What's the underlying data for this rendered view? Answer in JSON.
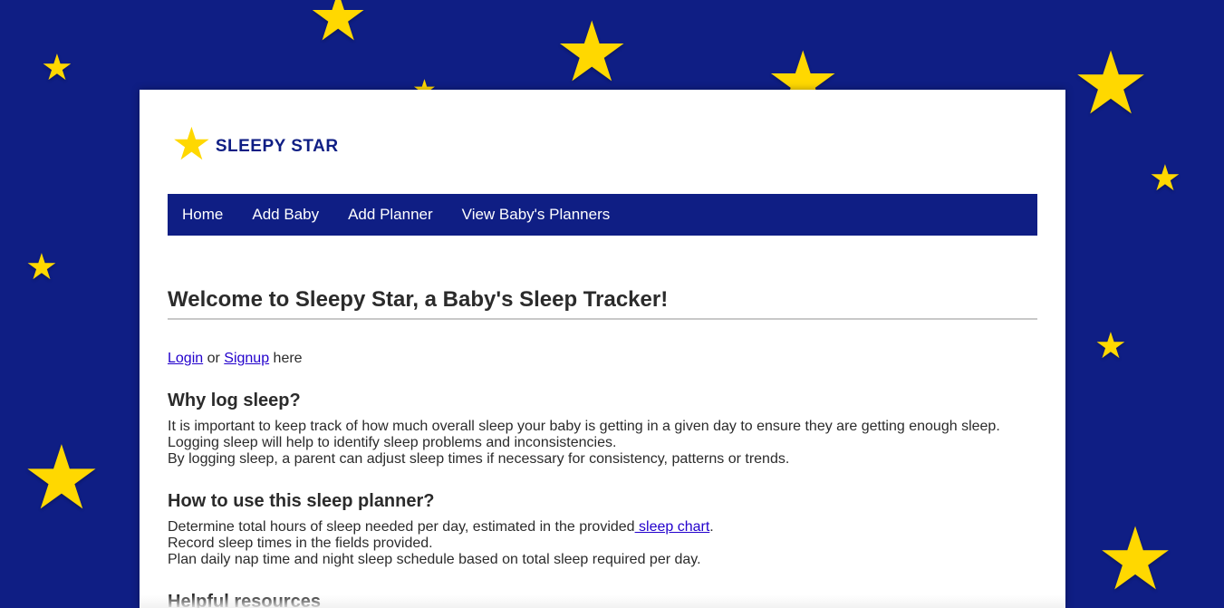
{
  "background": {
    "color": "#0f1e84",
    "star_color": "#ffd800",
    "star_icon": "star"
  },
  "logo": {
    "icon": "star",
    "text": "SLEEPY STAR"
  },
  "nav": {
    "items": [
      "Home",
      "Add Baby",
      "Add Planner",
      "View Baby's Planners"
    ]
  },
  "main": {
    "title": "Welcome to Sleepy Star, a Baby's Sleep Tracker!",
    "auth": {
      "login_label": "Login",
      "or_text": " or ",
      "signup_label": "Signup",
      "here_text": " here"
    },
    "sections": [
      {
        "heading": "Why log sleep?",
        "lines": [
          "It is important to keep track of how much overall sleep your baby is getting in a given day to ensure they are getting enough sleep.",
          "Logging sleep will help to identify sleep problems and inconsistencies.",
          "By logging sleep, a parent can adjust sleep times if necessary for consistency, patterns or trends."
        ]
      },
      {
        "heading": "How to use this sleep planner?",
        "line1_prefix": "Determine total hours of sleep needed per day, estimated in the provided",
        "line1_link": " sleep chart",
        "line1_suffix": ".",
        "lines": [
          "Record sleep times in the fields provided.",
          "Plan daily nap time and night sleep schedule based on total sleep required per day."
        ]
      },
      {
        "heading": "Helpful resources"
      }
    ]
  }
}
